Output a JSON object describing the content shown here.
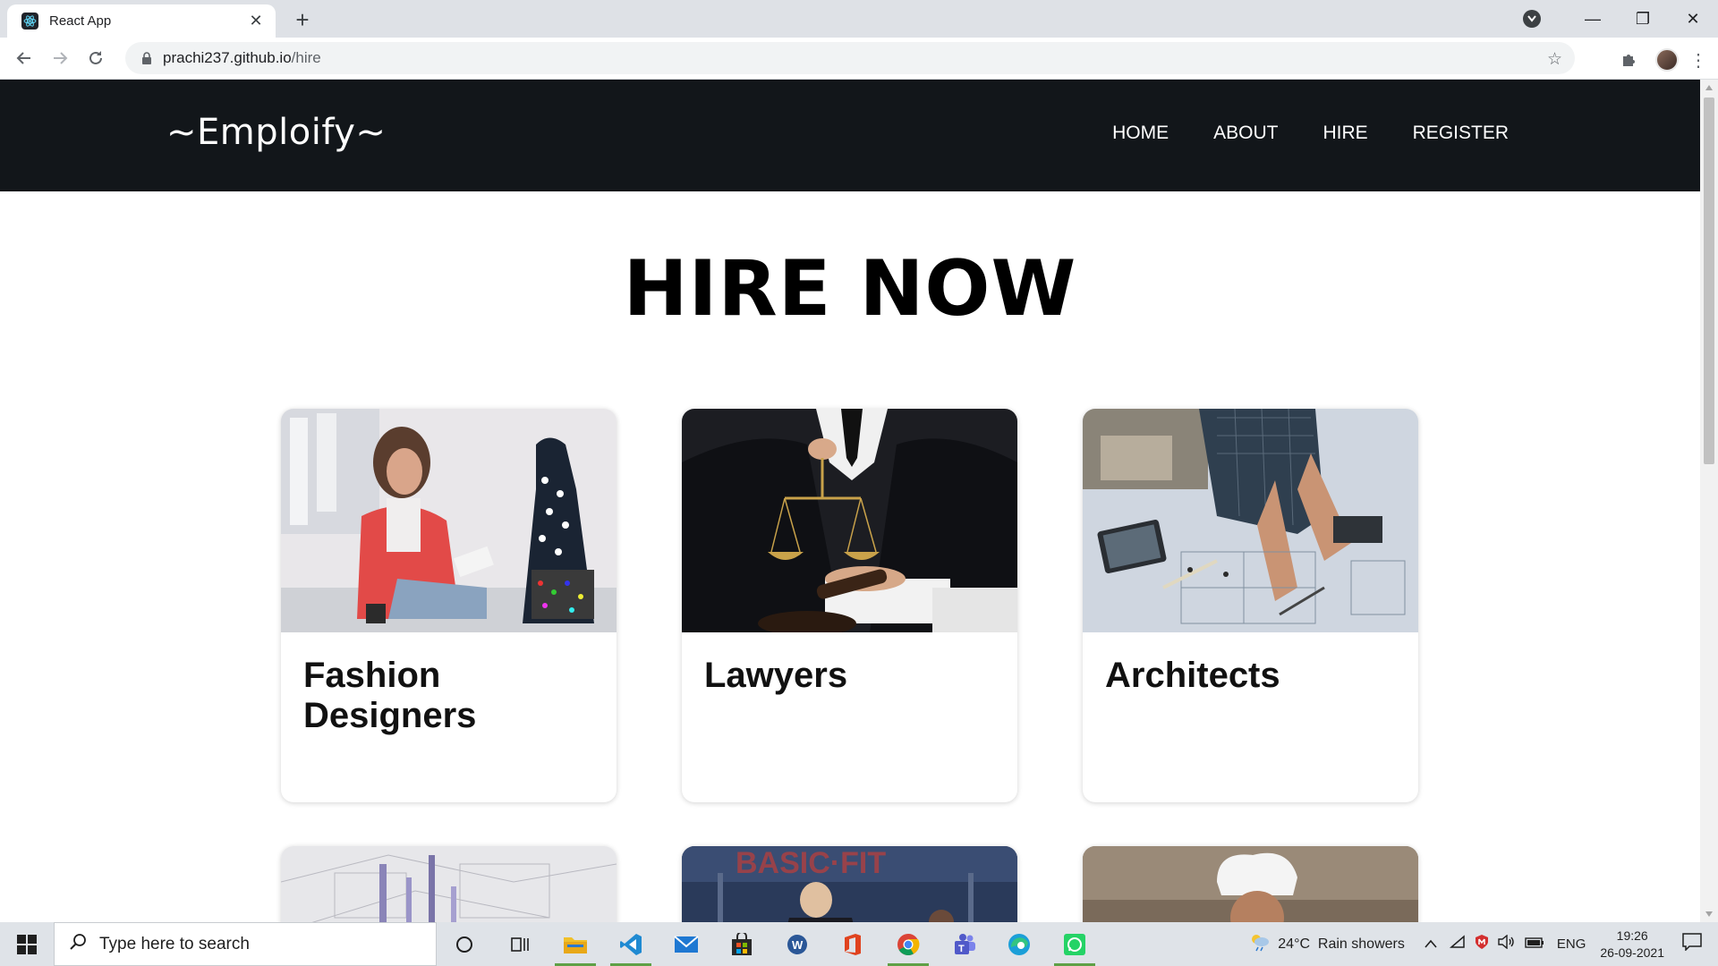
{
  "browser": {
    "tab_title": "React App",
    "url_host": "prachi237.github.io",
    "url_path": "/hire"
  },
  "site": {
    "brand": "~Emploify~",
    "nav": [
      "HOME",
      "ABOUT",
      "HIRE",
      "REGISTER"
    ],
    "heading": "HIRE NOW",
    "cards": [
      {
        "title": "Fashion Designers",
        "image": "fashion-designer-photo"
      },
      {
        "title": "Lawyers",
        "image": "lawyer-scales-photo"
      },
      {
        "title": "Architects",
        "image": "architect-blueprint-photo"
      }
    ],
    "cards_row2_images": [
      "architecture-model-photo",
      "gym-trainer-photo",
      "chef-photo"
    ]
  },
  "taskbar": {
    "search_placeholder": "Type here to search",
    "weather": "24°C  Rain showers",
    "language": "ENG",
    "time": "19:26",
    "date": "26-09-2021"
  },
  "colors": {
    "navbar_bg": "#12161a",
    "accent": "#5ea046"
  }
}
